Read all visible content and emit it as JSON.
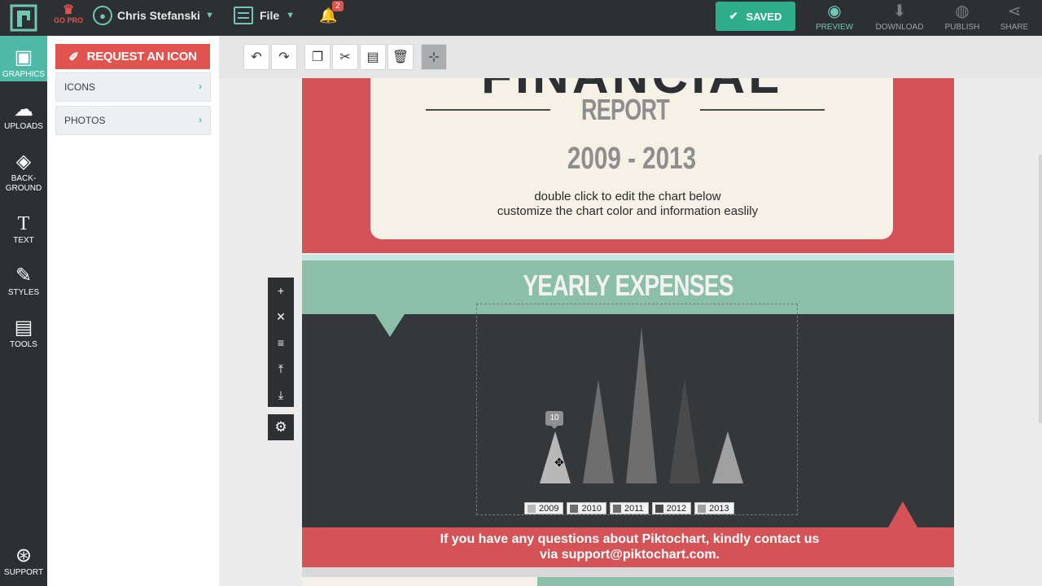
{
  "topbar": {
    "go_pro": "GO PRO",
    "user_name": "Chris Stefanski",
    "file_label": "File",
    "notification_count": "2",
    "saved_label": "SAVED",
    "actions": [
      {
        "label": "PREVIEW",
        "icon": "eye-icon"
      },
      {
        "label": "DOWNLOAD",
        "icon": "download-icon"
      },
      {
        "label": "PUBLISH",
        "icon": "globe-icon"
      },
      {
        "label": "SHARE",
        "icon": "share-icon"
      }
    ]
  },
  "rail": {
    "items": [
      {
        "label": "GRAPHICS",
        "icon": "image-icon"
      },
      {
        "label": "UPLOADS",
        "icon": "cloud-upload-icon"
      },
      {
        "label": "BACK-",
        "label2": "GROUND",
        "icon": "paint-bucket-icon"
      },
      {
        "label": "TEXT",
        "icon": "text-icon"
      },
      {
        "label": "STYLES",
        "icon": "styles-icon"
      },
      {
        "label": "TOOLS",
        "icon": "toolbox-icon"
      }
    ],
    "support_label": "SUPPORT"
  },
  "panel": {
    "request_label": "REQUEST AN ICON",
    "sections": [
      {
        "label": "ICONS"
      },
      {
        "label": "PHOTOS"
      }
    ]
  },
  "canvas": {
    "big_title": "FINANCIAL",
    "report": "REPORT",
    "years": "2009 - 2013",
    "edit_line1": "double click to edit the chart below",
    "edit_line2": "customize the chart color and information easlily",
    "section_title": "YEARLY EXPENSES",
    "contact_line1": "If you have any questions about Piktochart, kindly contact us",
    "contact_line2": "via support@piktochart.com."
  },
  "chart_data": {
    "type": "bar",
    "categories": [
      "2009",
      "2010",
      "2011",
      "2012",
      "2013"
    ],
    "values": [
      10,
      20,
      30,
      20,
      10
    ],
    "colors": [
      "#b8b8b8",
      "#6e6e6e",
      "#6e6e6e",
      "#4a4a4a",
      "#a0a0a0"
    ],
    "tooltip": "10",
    "ylim": [
      0,
      30
    ]
  },
  "colors": {
    "accent_teal": "#4fb9a8",
    "brand_red": "#e0534f",
    "saved_green": "#2fae8c",
    "dark": "#2d3032"
  }
}
